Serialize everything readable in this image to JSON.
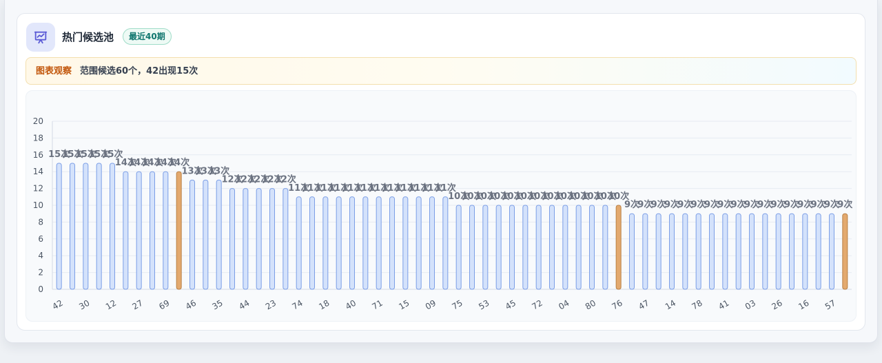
{
  "header": {
    "title": "热门候选池",
    "badge": "最近40期",
    "icon": "chart-presentation-icon"
  },
  "insight": {
    "label": "图表观察",
    "text": "范围候选60个，42出现15次"
  },
  "colors": {
    "bar_fill": "#d4e2fb",
    "bar_stroke": "#7b9ee6",
    "highlight_fill": "#e3a96e",
    "highlight_stroke": "#b98045",
    "badge_text": "#0f766e",
    "insight_label": "#c2570c"
  },
  "chart_data": {
    "type": "bar",
    "ylim": [
      0,
      20
    ],
    "yticks": [
      0,
      2,
      4,
      6,
      8,
      10,
      12,
      14,
      16,
      18,
      20
    ],
    "label_suffix": "次",
    "grid": true,
    "highlight_indices": [
      9,
      42,
      59
    ],
    "categories": [
      "42",
      "",
      "30",
      "",
      "12",
      "",
      "27",
      "",
      "69",
      "",
      "46",
      "",
      "35",
      "",
      "44",
      "",
      "23",
      "",
      "74",
      "",
      "18",
      "",
      "40",
      "",
      "71",
      "",
      "15",
      "",
      "09",
      "",
      "75",
      "",
      "53",
      "",
      "45",
      "",
      "72",
      "",
      "04",
      "",
      "80",
      "",
      "76",
      "",
      "47",
      "",
      "14",
      "",
      "78",
      "",
      "41",
      "",
      "03",
      "",
      "26",
      "",
      "16",
      "",
      "57",
      ""
    ],
    "values": [
      15,
      15,
      15,
      15,
      15,
      14,
      14,
      14,
      14,
      14,
      13,
      13,
      13,
      12,
      12,
      12,
      12,
      12,
      11,
      11,
      11,
      11,
      11,
      11,
      11,
      11,
      11,
      11,
      11,
      11,
      10,
      10,
      10,
      10,
      10,
      10,
      10,
      10,
      10,
      10,
      10,
      10,
      10,
      9,
      9,
      9,
      9,
      9,
      9,
      9,
      9,
      9,
      9,
      9,
      9,
      9,
      9,
      9,
      9,
      9
    ]
  }
}
